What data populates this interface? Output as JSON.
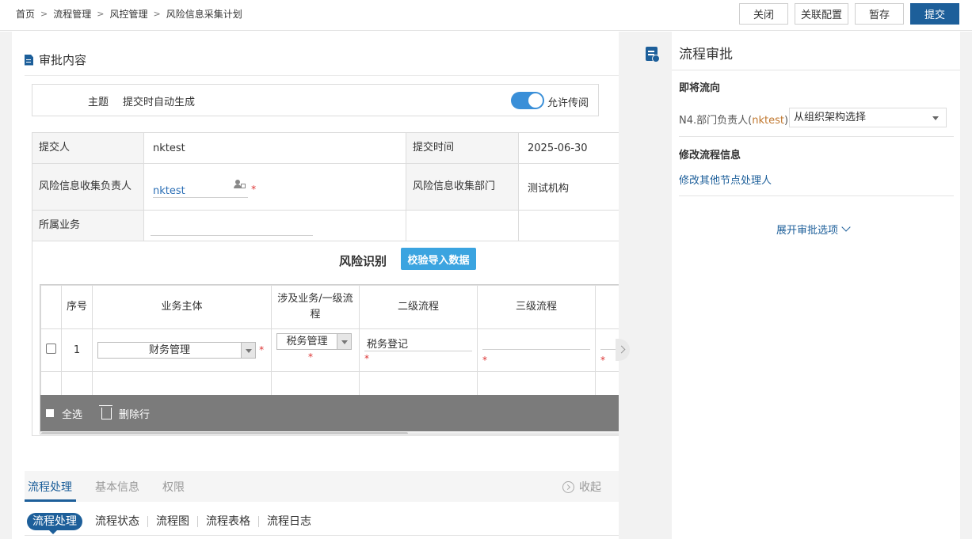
{
  "breadcrumb": [
    "首页",
    "流程管理",
    "风控管理",
    "风险信息采集计划"
  ],
  "toolbar": {
    "close": "关闭",
    "link_config": "关联配置",
    "save_draft": "暂存",
    "submit": "提交"
  },
  "section": {
    "title": "审批内容"
  },
  "subject": {
    "label": "主题",
    "value": "提交时自动生成",
    "toggle_label": "允许传阅",
    "toggle_on": "true"
  },
  "info": {
    "submitter_label": "提交人",
    "submitter_value": "nktest",
    "submit_time_label": "提交时间",
    "submit_time_value": "2025-06-30",
    "owner_label": "风险信息收集负责人",
    "owner_value": "nktest",
    "dept_label": "风险信息收集部门",
    "dept_value": "测试机构",
    "business_label": "所属业务"
  },
  "risk": {
    "title": "风险识别",
    "verify_button": "校验导入数据",
    "columns": [
      "序号",
      "业务主体",
      "涉及业务/一级流程",
      "二级流程",
      "三级流程"
    ],
    "rows": [
      {
        "index": "1",
        "entity": "财务管理",
        "business": "税务管理",
        "level2": "税务登记",
        "level3": ""
      }
    ],
    "select_all": "全选",
    "delete_row": "删除行"
  },
  "tabs": {
    "items": [
      "流程处理",
      "基本信息",
      "权限"
    ],
    "collapse": "收起"
  },
  "subtabs": [
    "流程处理",
    "流程状态",
    "流程图",
    "流程表格",
    "流程日志"
  ],
  "approval": {
    "title": "流程审批",
    "next_flow_heading": "即将流向",
    "node_label": "N4.部门负责人(",
    "node_user": "nktest",
    "node_close": ")",
    "select_value": "从组织架构选择",
    "modify_heading": "修改流程信息",
    "modify_link": "修改其他节点处理人",
    "expand_options": "展开审批选项"
  },
  "colors": {
    "primary": "#1d5f9a",
    "accent_button": "#3ba4e0",
    "toggle": "#3a8fd8",
    "required": "#dd3333"
  }
}
